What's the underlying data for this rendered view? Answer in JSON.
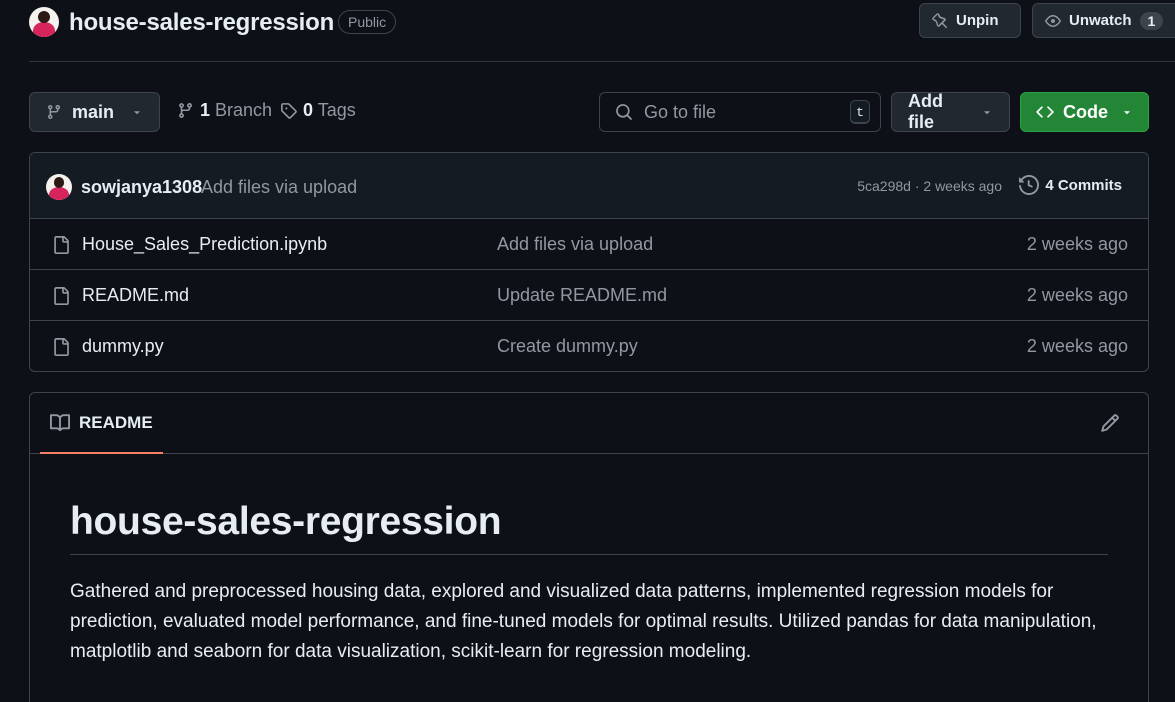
{
  "repo": {
    "name": "house-sales-regression",
    "visibility": "Public",
    "unpin_label": "Unpin",
    "unwatch_label": "Unwatch",
    "watch_count": "1"
  },
  "nav": {
    "branch": "main",
    "branches_count": "1",
    "branches_label": "Branch",
    "tags_count": "0",
    "tags_label": "Tags",
    "goto_placeholder": "Go to file",
    "goto_shortcut": "t",
    "add_file_label": "Add file",
    "code_label": "Code"
  },
  "latest_commit": {
    "author": "sowjanya1308",
    "message": "Add files via upload",
    "meta": "5ca298d · 2 weeks ago",
    "commits_label": "4 Commits"
  },
  "files": [
    {
      "name": "House_Sales_Prediction.ipynb",
      "commit": "Add files via upload",
      "age": "2 weeks ago"
    },
    {
      "name": "README.md",
      "commit": "Update README.md",
      "age": "2 weeks ago"
    },
    {
      "name": "dummy.py",
      "commit": "Create dummy.py",
      "age": "2 weeks ago"
    }
  ],
  "readme": {
    "tab_label": "README",
    "title": "house-sales-regression",
    "description": "Gathered and preprocessed housing data, explored and visualized data patterns, implemented regression models for prediction, evaluated model performance, and fine-tuned models for optimal results. Utilized pandas for data manipulation, matplotlib and seaborn for data visualization, scikit-learn for regression modeling."
  },
  "colors": {
    "background": "#0d1117",
    "border": "#3d444d",
    "primary_button": "#238636",
    "tab_underline": "#f78166",
    "muted_text": "#9198a1"
  },
  "icons": [
    "avatar",
    "pin-icon",
    "eye-icon",
    "branch-icon",
    "tag-icon",
    "search-icon",
    "code-icon",
    "history-icon",
    "file-icon",
    "book-icon",
    "pencil-icon",
    "chevron-down-icon"
  ]
}
